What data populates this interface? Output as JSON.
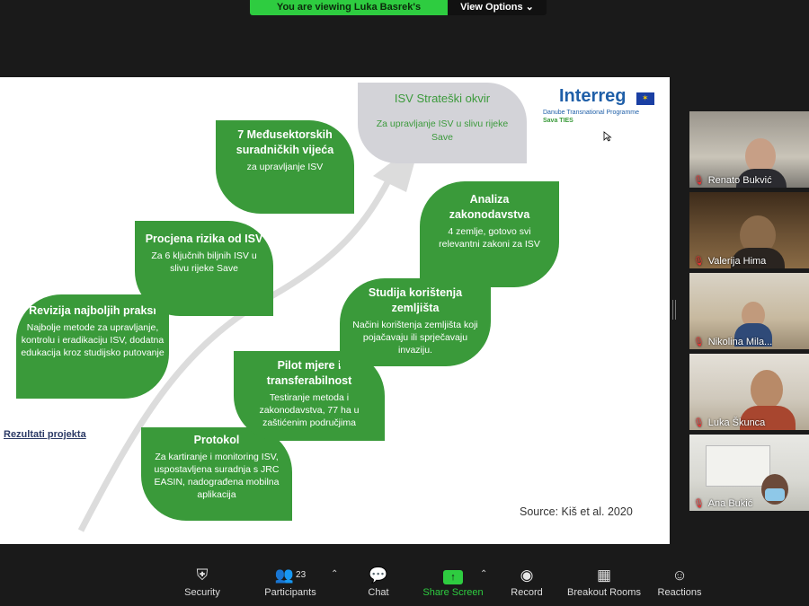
{
  "banner": {
    "text": "You are viewing Luka Basrek's screen",
    "view_options": "View Options"
  },
  "slide": {
    "goal": {
      "title": "ISV Strateški okvir",
      "text": "Za upravljanje ISV u slivu rijeke Save"
    },
    "logo": {
      "word": "Interreg",
      "sub": "Danube Transnational Programme",
      "sub2": "Sava TIES"
    },
    "leaves": [
      {
        "title": "Protokol",
        "text": "Za kartiranje i monitoring ISV, uspostavljena suradnja s JRC EASIN, nadograđena mobilna aplikacija"
      },
      {
        "title": "Pilot mjere i transferabilnost",
        "text": "Testiranje metoda i zakonodavstva, 77 ha u zaštićenim područjima"
      },
      {
        "title": "Studija korištenja zemljišta",
        "text": "Načini korištenja zemljišta koji pojačavaju ili sprječavaju invaziju."
      },
      {
        "title": "Revizija najboljih praksi",
        "text": "Najbolje metode za upravljanje, kontrolu i eradikaciju ISV, dodatna edukacija kroz studijsko putovanje"
      },
      {
        "title": "Procjena rizika od ISV",
        "text": "Za 6 ključnih biljnih ISV u slivu rijeke Save"
      },
      {
        "title": "7 Međusektorskih suradničkih vijeća",
        "text": "za upravljanje ISV"
      },
      {
        "title": "Analiza zakonodavstva",
        "text": "4 zemlje, gotovo svi relevantni zakoni za ISV"
      }
    ],
    "rezultati": "Rezultati projekta",
    "source": "Source: Kiš et al. 2020"
  },
  "participants": [
    {
      "name": "Renato Bukvić"
    },
    {
      "name": "Valerija Hima"
    },
    {
      "name": "Nikolina Mila..."
    },
    {
      "name": "Luka Škunca"
    },
    {
      "name": "Ana Bukić"
    }
  ],
  "toolbar": {
    "security": "Security",
    "participants": "Participants",
    "participants_count": "23",
    "chat": "Chat",
    "share_screen": "Share Screen",
    "record": "Record",
    "breakout_rooms": "Breakout Rooms",
    "reactions": "Reactions"
  },
  "colors": {
    "leaf_green": "#3a9a3a",
    "share_green": "#2ecc40",
    "goal_grey": "#d3d3d8"
  }
}
